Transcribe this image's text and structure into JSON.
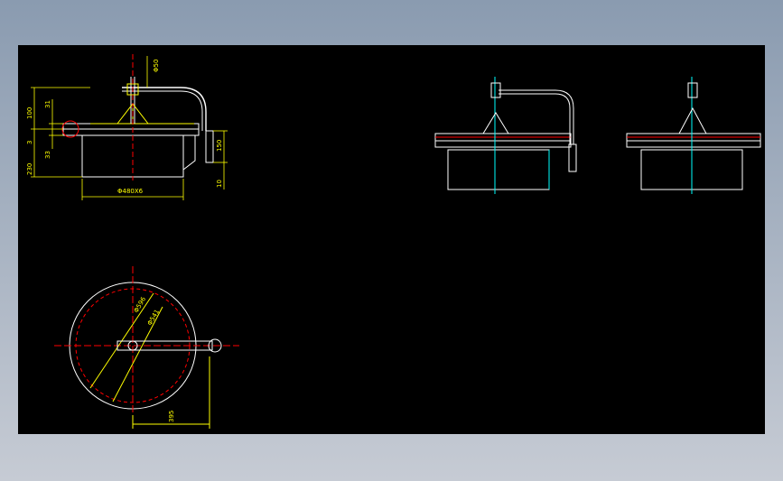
{
  "background": {
    "gradient_top": "#8a9bb0",
    "gradient_bottom": "#c6cbd4"
  },
  "canvas_color": "#000000",
  "colors": {
    "outline": "#ffffff",
    "dimension": "#ffff00",
    "centerline": "#ff0000",
    "axis": "#00ffff"
  },
  "labels": {
    "top_pipe_dia": "Φ50",
    "h100": "100",
    "h31": "31",
    "h3": "3",
    "h33": "33",
    "h230": "230",
    "h150": "150",
    "h10": "10",
    "bottom_dia": "Φ480X6",
    "plan_dia1": "Φ596",
    "plan_dia2": "Φ541",
    "plan_len": "395"
  }
}
